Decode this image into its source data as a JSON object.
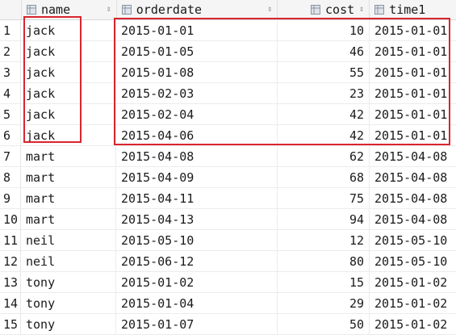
{
  "columns": [
    {
      "key": "name",
      "label": "name",
      "icon": "column-icon"
    },
    {
      "key": "orderdate",
      "label": "orderdate",
      "icon": "column-icon"
    },
    {
      "key": "cost",
      "label": "cost",
      "icon": "column-icon"
    },
    {
      "key": "time1",
      "label": "time1",
      "icon": "column-icon"
    }
  ],
  "sort_indicator": "⇕",
  "rows": [
    {
      "num": "1",
      "name": "jack",
      "orderdate": "2015-01-01",
      "cost": "10",
      "time1": "2015-01-01"
    },
    {
      "num": "2",
      "name": "jack",
      "orderdate": "2015-01-05",
      "cost": "46",
      "time1": "2015-01-01"
    },
    {
      "num": "3",
      "name": "jack",
      "orderdate": "2015-01-08",
      "cost": "55",
      "time1": "2015-01-01"
    },
    {
      "num": "4",
      "name": "jack",
      "orderdate": "2015-02-03",
      "cost": "23",
      "time1": "2015-01-01"
    },
    {
      "num": "5",
      "name": "jack",
      "orderdate": "2015-02-04",
      "cost": "42",
      "time1": "2015-01-01"
    },
    {
      "num": "6",
      "name": "jack",
      "orderdate": "2015-04-06",
      "cost": "42",
      "time1": "2015-01-01"
    },
    {
      "num": "7",
      "name": "mart",
      "orderdate": "2015-04-08",
      "cost": "62",
      "time1": "2015-04-08"
    },
    {
      "num": "8",
      "name": "mart",
      "orderdate": "2015-04-09",
      "cost": "68",
      "time1": "2015-04-08"
    },
    {
      "num": "9",
      "name": "mart",
      "orderdate": "2015-04-11",
      "cost": "75",
      "time1": "2015-04-08"
    },
    {
      "num": "10",
      "name": "mart",
      "orderdate": "2015-04-13",
      "cost": "94",
      "time1": "2015-04-08"
    },
    {
      "num": "11",
      "name": "neil",
      "orderdate": "2015-05-10",
      "cost": "12",
      "time1": "2015-05-10"
    },
    {
      "num": "12",
      "name": "neil",
      "orderdate": "2015-06-12",
      "cost": "80",
      "time1": "2015-05-10"
    },
    {
      "num": "13",
      "name": "tony",
      "orderdate": "2015-01-02",
      "cost": "15",
      "time1": "2015-01-02"
    },
    {
      "num": "14",
      "name": "tony",
      "orderdate": "2015-01-04",
      "cost": "29",
      "time1": "2015-01-02"
    },
    {
      "num": "15",
      "name": "tony",
      "orderdate": "2015-01-07",
      "cost": "50",
      "time1": "2015-01-02"
    }
  ],
  "colors": {
    "highlight": "#d9252f",
    "header_bg": "#f5f5f5"
  }
}
